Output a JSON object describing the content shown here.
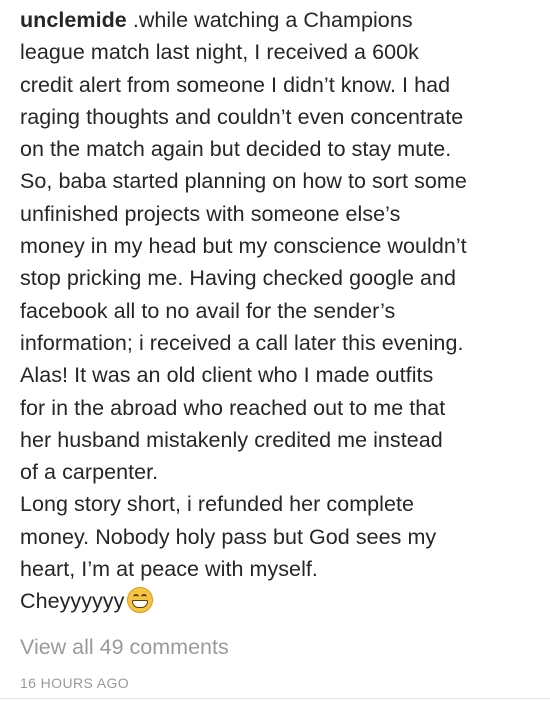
{
  "post": {
    "username": "unclemide",
    "caption_lines": [
      " .while watching a Champions",
      "league match last night, I received a 600k",
      "credit alert from someone I didn’t know. I had",
      "raging thoughts and couldn’t even concentrate",
      "on the match again but decided to stay mute.",
      "So, baba started planning on how to sort some",
      "unfinished projects with someone else’s",
      "money in my head but my conscience wouldn’t",
      "stop pricking me. Having checked google and",
      "facebook all to no avail for the sender’s",
      "information; i received a call later this evening.",
      "Alas! It was an old client who I made outfits",
      "for in the abroad who reached out to me that",
      "her husband mistakenly credited me instead",
      "of a carpenter.",
      "Long story short, i refunded her complete",
      "money. Nobody holy pass but God sees my",
      "heart, I’m at peace with myself.",
      "Cheyyyyyy"
    ],
    "emoji": "grinning-face-icon",
    "view_comments": "View all 49 comments",
    "timestamp": "16 HOURS AGO"
  }
}
